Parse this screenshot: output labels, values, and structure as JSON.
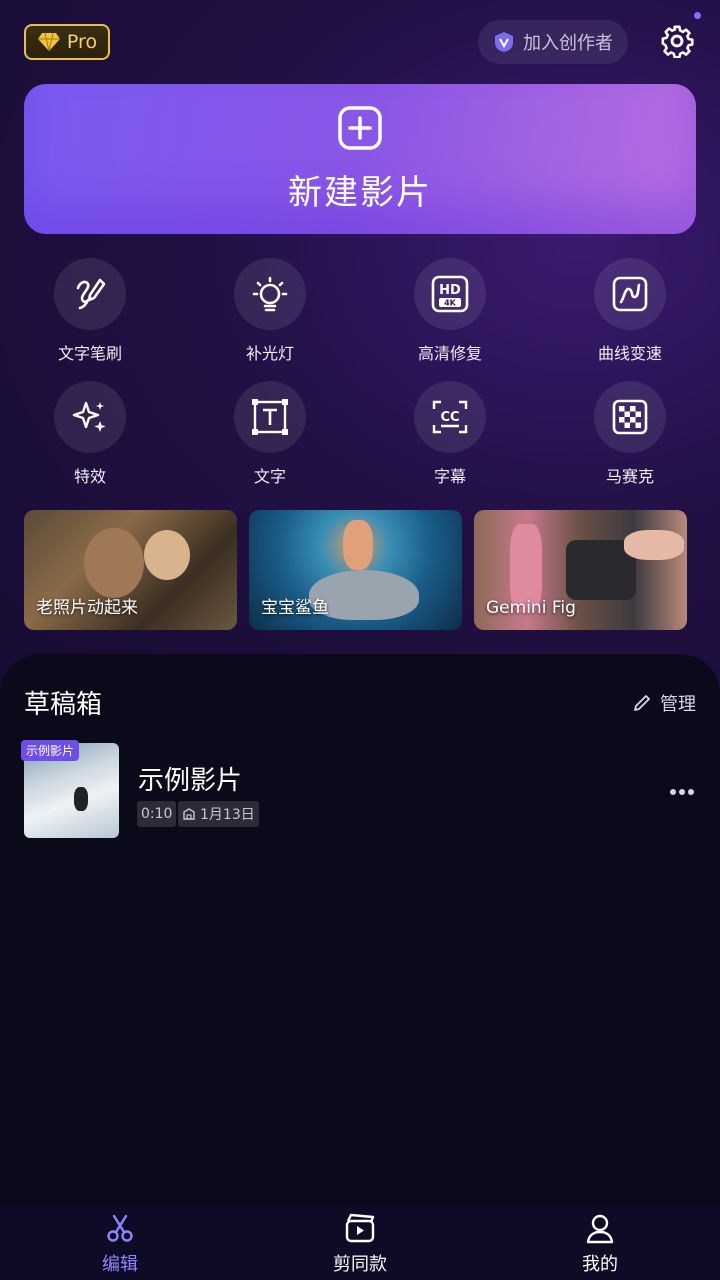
{
  "header": {
    "pro_label": "Pro",
    "creator_label": "加入创作者"
  },
  "new_movie": {
    "label": "新建影片"
  },
  "tools": [
    {
      "label": "文字笔刷",
      "icon": "brush-icon"
    },
    {
      "label": "补光灯",
      "icon": "lightbulb-icon"
    },
    {
      "label": "高清修复",
      "icon": "hd-4k-icon"
    },
    {
      "label": "曲线变速",
      "icon": "curve-icon"
    },
    {
      "label": "特效",
      "icon": "sparkle-icon"
    },
    {
      "label": "文字",
      "icon": "text-icon"
    },
    {
      "label": "字幕",
      "icon": "caption-icon"
    },
    {
      "label": "马赛克",
      "icon": "mosaic-icon"
    }
  ],
  "templates": [
    {
      "title": "老照片动起来 "
    },
    {
      "title": "宝宝鲨鱼"
    },
    {
      "title": "Gemini Fig"
    }
  ],
  "drafts": {
    "title": "草稿箱",
    "manage_label": "管理",
    "items": [
      {
        "tag": "示例影片",
        "name": "示例影片",
        "duration": "0:10",
        "date": "1月13日"
      }
    ]
  },
  "nav": [
    {
      "label": "编辑",
      "icon": "scissors-icon",
      "active": true
    },
    {
      "label": "剪同款",
      "icon": "clapper-icon",
      "active": false
    },
    {
      "label": "我的",
      "icon": "user-icon",
      "active": false
    }
  ],
  "colors": {
    "accent": "#8f86ff",
    "pro_gold": "#e8c248",
    "new_movie_gradient_start": "#7b5af2",
    "new_movie_gradient_end": "#b76de0"
  }
}
